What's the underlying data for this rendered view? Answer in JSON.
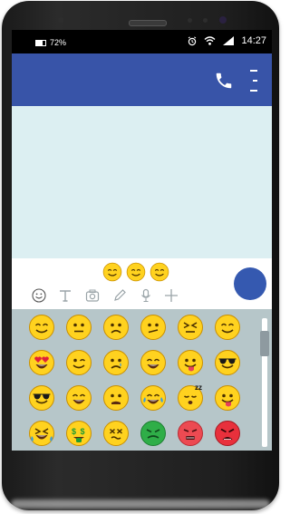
{
  "status": {
    "battery": "72%",
    "time": "14:27"
  },
  "icons": {
    "call": "phone-icon",
    "menu": "more-vert-icon",
    "signal": "signal-icon",
    "wifi": "wifi-icon",
    "alarm": "alarm-icon",
    "battery": "battery-icon",
    "smiley": "emoji-icon",
    "text": "text-format-icon",
    "camera": "camera-icon",
    "pen": "pen-icon",
    "mic": "mic-icon",
    "plus": "plus-icon"
  },
  "composer": {
    "draft_emoji": [
      "smiling",
      "smiling",
      "smiling"
    ]
  },
  "emoji_grid": [
    [
      "smiling",
      "neutral",
      "frowning",
      "confused",
      "squinting",
      "smiling"
    ],
    [
      "heart-eyes",
      "winking",
      "crying",
      "grinning",
      "tongue-out",
      "sunglasses"
    ],
    [
      "sunglasses",
      "grinning",
      "worried",
      "crying-laughing",
      "sleeping",
      "tongue-out"
    ],
    [
      "laughing-tears",
      "money-mouth",
      "dizzy",
      "nauseated",
      "angry",
      "angry-red"
    ]
  ],
  "colors": {
    "appbar": "#3854a8",
    "chat_bg": "#dceff2",
    "panel_bg": "#b6c6c9",
    "send_button": "#3559b0",
    "emoji_yellow": "#ffd21f"
  }
}
